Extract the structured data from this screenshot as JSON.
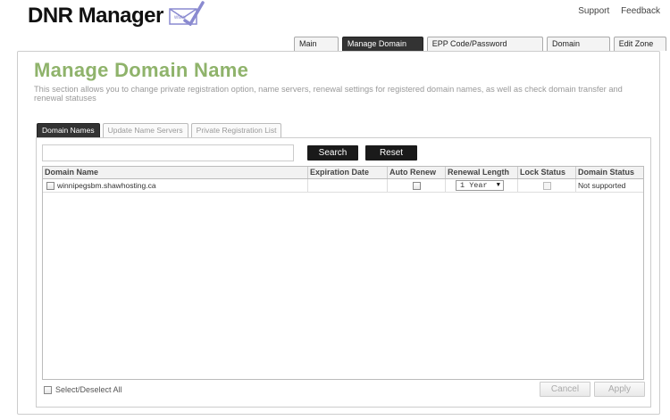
{
  "header": {
    "logo_text": "DNR Manager",
    "logo_icon_label": "www",
    "links": {
      "support": "Support",
      "feedback": "Feedback"
    }
  },
  "nav": {
    "tabs": [
      {
        "label": "Main Menu",
        "active": false
      },
      {
        "label": "Manage Domain Name",
        "active": true
      },
      {
        "label": "EPP Code/Password Management",
        "active": false
      },
      {
        "label": "Domain Contacts",
        "active": false
      },
      {
        "label": "Edit Zone File",
        "active": false
      }
    ]
  },
  "page": {
    "title": "Manage Domain Name",
    "description": "This section allows you to change private registration option, name servers, renewal settings for registered domain names, as well as check domain transfer and renewal statuses"
  },
  "sub_tabs": [
    {
      "label": "Domain Names",
      "active": true
    },
    {
      "label": "Update Name Servers",
      "active": false
    },
    {
      "label": "Private Registration List",
      "active": false
    }
  ],
  "search": {
    "value": "",
    "placeholder": "",
    "search_label": "Search",
    "reset_label": "Reset"
  },
  "table": {
    "columns": [
      "Domain Name",
      "Expiration Date",
      "Auto Renew",
      "Renewal Length",
      "Lock Status",
      "Domain Status"
    ],
    "rows": [
      {
        "domain": "winnipegsbm.shawhosting.ca",
        "expiration": "",
        "auto_renew": false,
        "renewal_length": "1 Year",
        "lock_status": false,
        "status": "Not supported"
      }
    ]
  },
  "footer": {
    "select_all_label": "Select/Deselect All",
    "cancel_label": "Cancel",
    "apply_label": "Apply"
  },
  "colors": {
    "title_green": "#8fb36b",
    "active_tab": "#333333",
    "button_dark": "#1a1a1a"
  }
}
